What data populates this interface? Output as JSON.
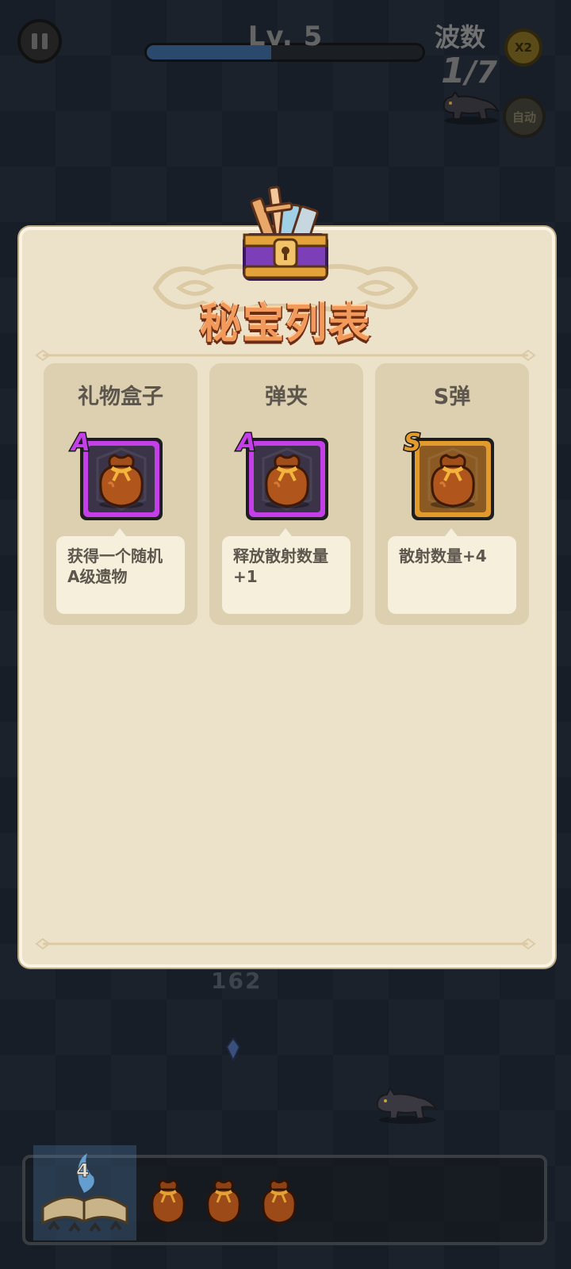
{
  "hud": {
    "level_text": "Lv. 5",
    "level_progress": 0.45,
    "wave_label": "波数",
    "wave_current": "1",
    "wave_total": "/7",
    "speed_label": "X2",
    "auto_label": "自动"
  },
  "panel": {
    "title": "秘宝列表",
    "items": [
      {
        "name": "礼物盒子",
        "rank": "A",
        "icon": "loot-bag-icon",
        "frame_color": "#c53fe8",
        "description": "获得一个随机A级遗物"
      },
      {
        "name": "弹夹",
        "rank": "A",
        "icon": "loot-bag-icon",
        "frame_color": "#c53fe8",
        "description": "释放散射数量+1"
      },
      {
        "name": "S弹",
        "rank": "S",
        "icon": "loot-bag-icon",
        "frame_color": "#e39a2c",
        "description": "散射数量+4"
      }
    ]
  },
  "battlefield": {
    "damage_number": "162"
  },
  "tray": {
    "book_level": "4",
    "bag_count": 3
  },
  "colors": {
    "panel_bg": "#ece2c9",
    "card_bg": "#ddd0b1",
    "title_fill": "#f19a5b",
    "title_stroke": "#7b3319",
    "rank_a": "#c53fe8",
    "rank_s": "#e39a2c"
  }
}
